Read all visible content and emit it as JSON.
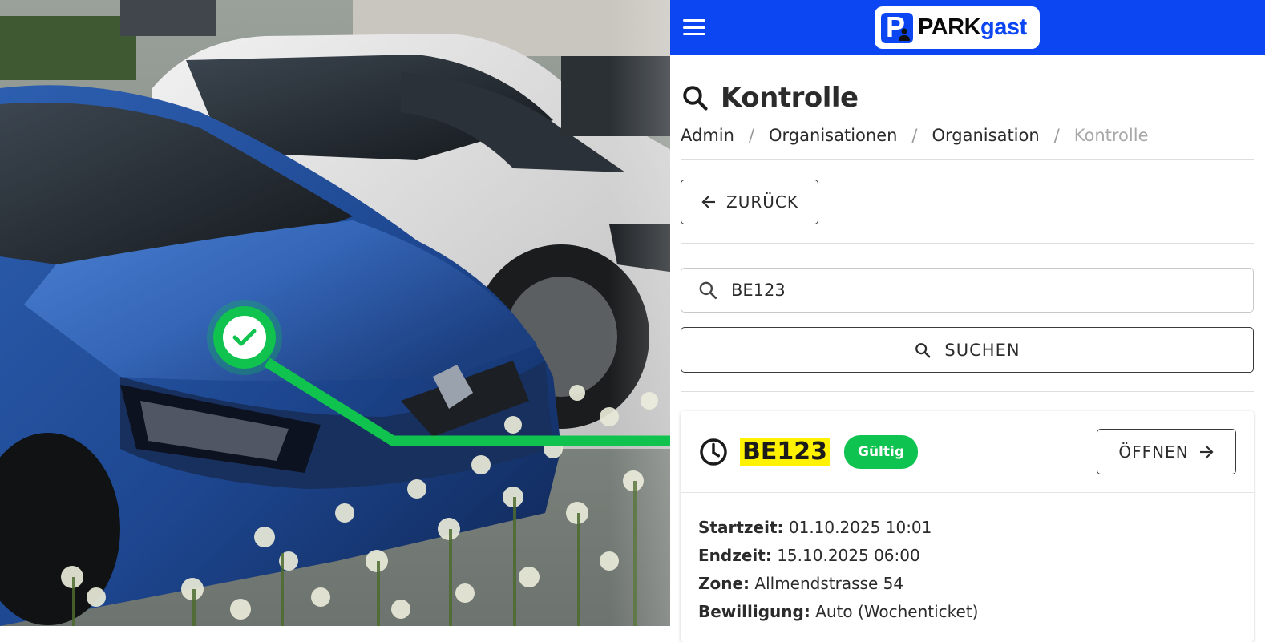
{
  "header": {
    "logo_part1": "PARK",
    "logo_part2": "gast",
    "logo_icon_letter": "P"
  },
  "page": {
    "title": "Kontrolle"
  },
  "breadcrumb": {
    "items": [
      "Admin",
      "Organisationen",
      "Organisation",
      "Kontrolle"
    ],
    "separator": "/"
  },
  "actions": {
    "back_label": "ZURÜCK",
    "search_label": "SUCHEN"
  },
  "search": {
    "value": "BE123"
  },
  "result": {
    "plate": "BE123",
    "status": "Gültig",
    "open_label": "ÖFFNEN",
    "details": [
      {
        "label": "Startzeit:",
        "value": "01.10.2025 10:01"
      },
      {
        "label": "Endzeit:",
        "value": "15.10.2025 06:00"
      },
      {
        "label": "Zone:",
        "value": "Allmendstrasse 54"
      },
      {
        "label": "Bewilligung:",
        "value": "Auto (Wochenticket)"
      }
    ]
  },
  "colors": {
    "brand_blue": "#0b46f2",
    "valid_green": "#0fc350",
    "plate_highlight": "#fff200"
  },
  "icons": [
    "menu-icon",
    "search-icon",
    "arrow-left-icon",
    "clock-icon",
    "arrow-right-icon",
    "check-icon"
  ]
}
